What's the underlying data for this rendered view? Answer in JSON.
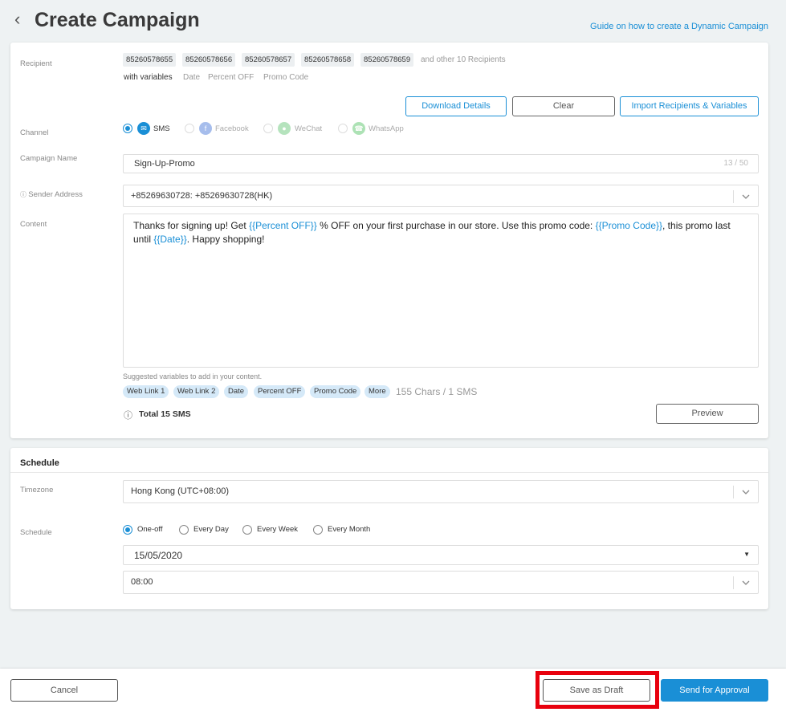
{
  "header": {
    "back_icon": "chevron-left",
    "title": "Create Campaign",
    "guide_link": "Guide on how to create a Dynamic Campaign"
  },
  "recipient": {
    "label": "Recipient",
    "numbers": [
      "85260578655",
      "85260578656",
      "85260578657",
      "85260578658",
      "85260578659"
    ],
    "others": "and other 10 Recipients",
    "with_variables": "with variables",
    "variables": [
      "Date",
      "Percent OFF",
      "Promo Code"
    ],
    "buttons": {
      "download": "Download Details",
      "clear": "Clear",
      "import": "Import Recipients & Variables"
    }
  },
  "channel": {
    "label": "Channel",
    "options": [
      {
        "label": "SMS",
        "selected": true,
        "icon": "sms-icon",
        "color": "#1a8fd6"
      },
      {
        "label": "Facebook",
        "selected": false,
        "icon": "facebook-icon",
        "color": "#3b6fd6"
      },
      {
        "label": "WeChat",
        "selected": false,
        "icon": "wechat-icon",
        "color": "#5cc36f"
      },
      {
        "label": "WhatsApp",
        "selected": false,
        "icon": "whatsapp-icon",
        "color": "#4cc15c"
      }
    ]
  },
  "campaign_name": {
    "label": "Campaign Name",
    "value": "Sign-Up-Promo",
    "counter": "13 / 50"
  },
  "sender": {
    "label": "Sender Address",
    "value": "+85269630728: +85269630728(HK)"
  },
  "content": {
    "label": "Content",
    "t1": "Thanks for signing up! Get ",
    "v1": "{{Percent OFF}}",
    "t2": " % OFF on your first purchase in our store. Use this promo code: ",
    "v2": "{{Promo Code}}",
    "t3": ", this promo last until ",
    "v3": "{{Date}}",
    "t4": ". Happy shopping!",
    "suggested_label": "Suggested variables to add in your content.",
    "suggested": [
      "Web Link 1",
      "Web Link 2",
      "Date",
      "Percent OFF",
      "Promo Code",
      "More"
    ],
    "chars": "155 Chars / 1 SMS",
    "total": "Total 15 SMS",
    "preview_button": "Preview"
  },
  "schedule": {
    "section_title": "Schedule",
    "timezone_label": "Timezone",
    "timezone_value": "Hong Kong (UTC+08:00)",
    "schedule_label": "Schedule",
    "options": [
      {
        "label": "One-off",
        "selected": true
      },
      {
        "label": "Every Day",
        "selected": false
      },
      {
        "label": "Every Week",
        "selected": false
      },
      {
        "label": "Every Month",
        "selected": false
      }
    ],
    "date": "15/05/2020",
    "time": "08:00"
  },
  "footer": {
    "cancel": "Cancel",
    "save_draft": "Save as Draft",
    "send": "Send for Approval"
  },
  "colors": {
    "accent": "#1a8fd6",
    "highlight": "#e8000d"
  }
}
